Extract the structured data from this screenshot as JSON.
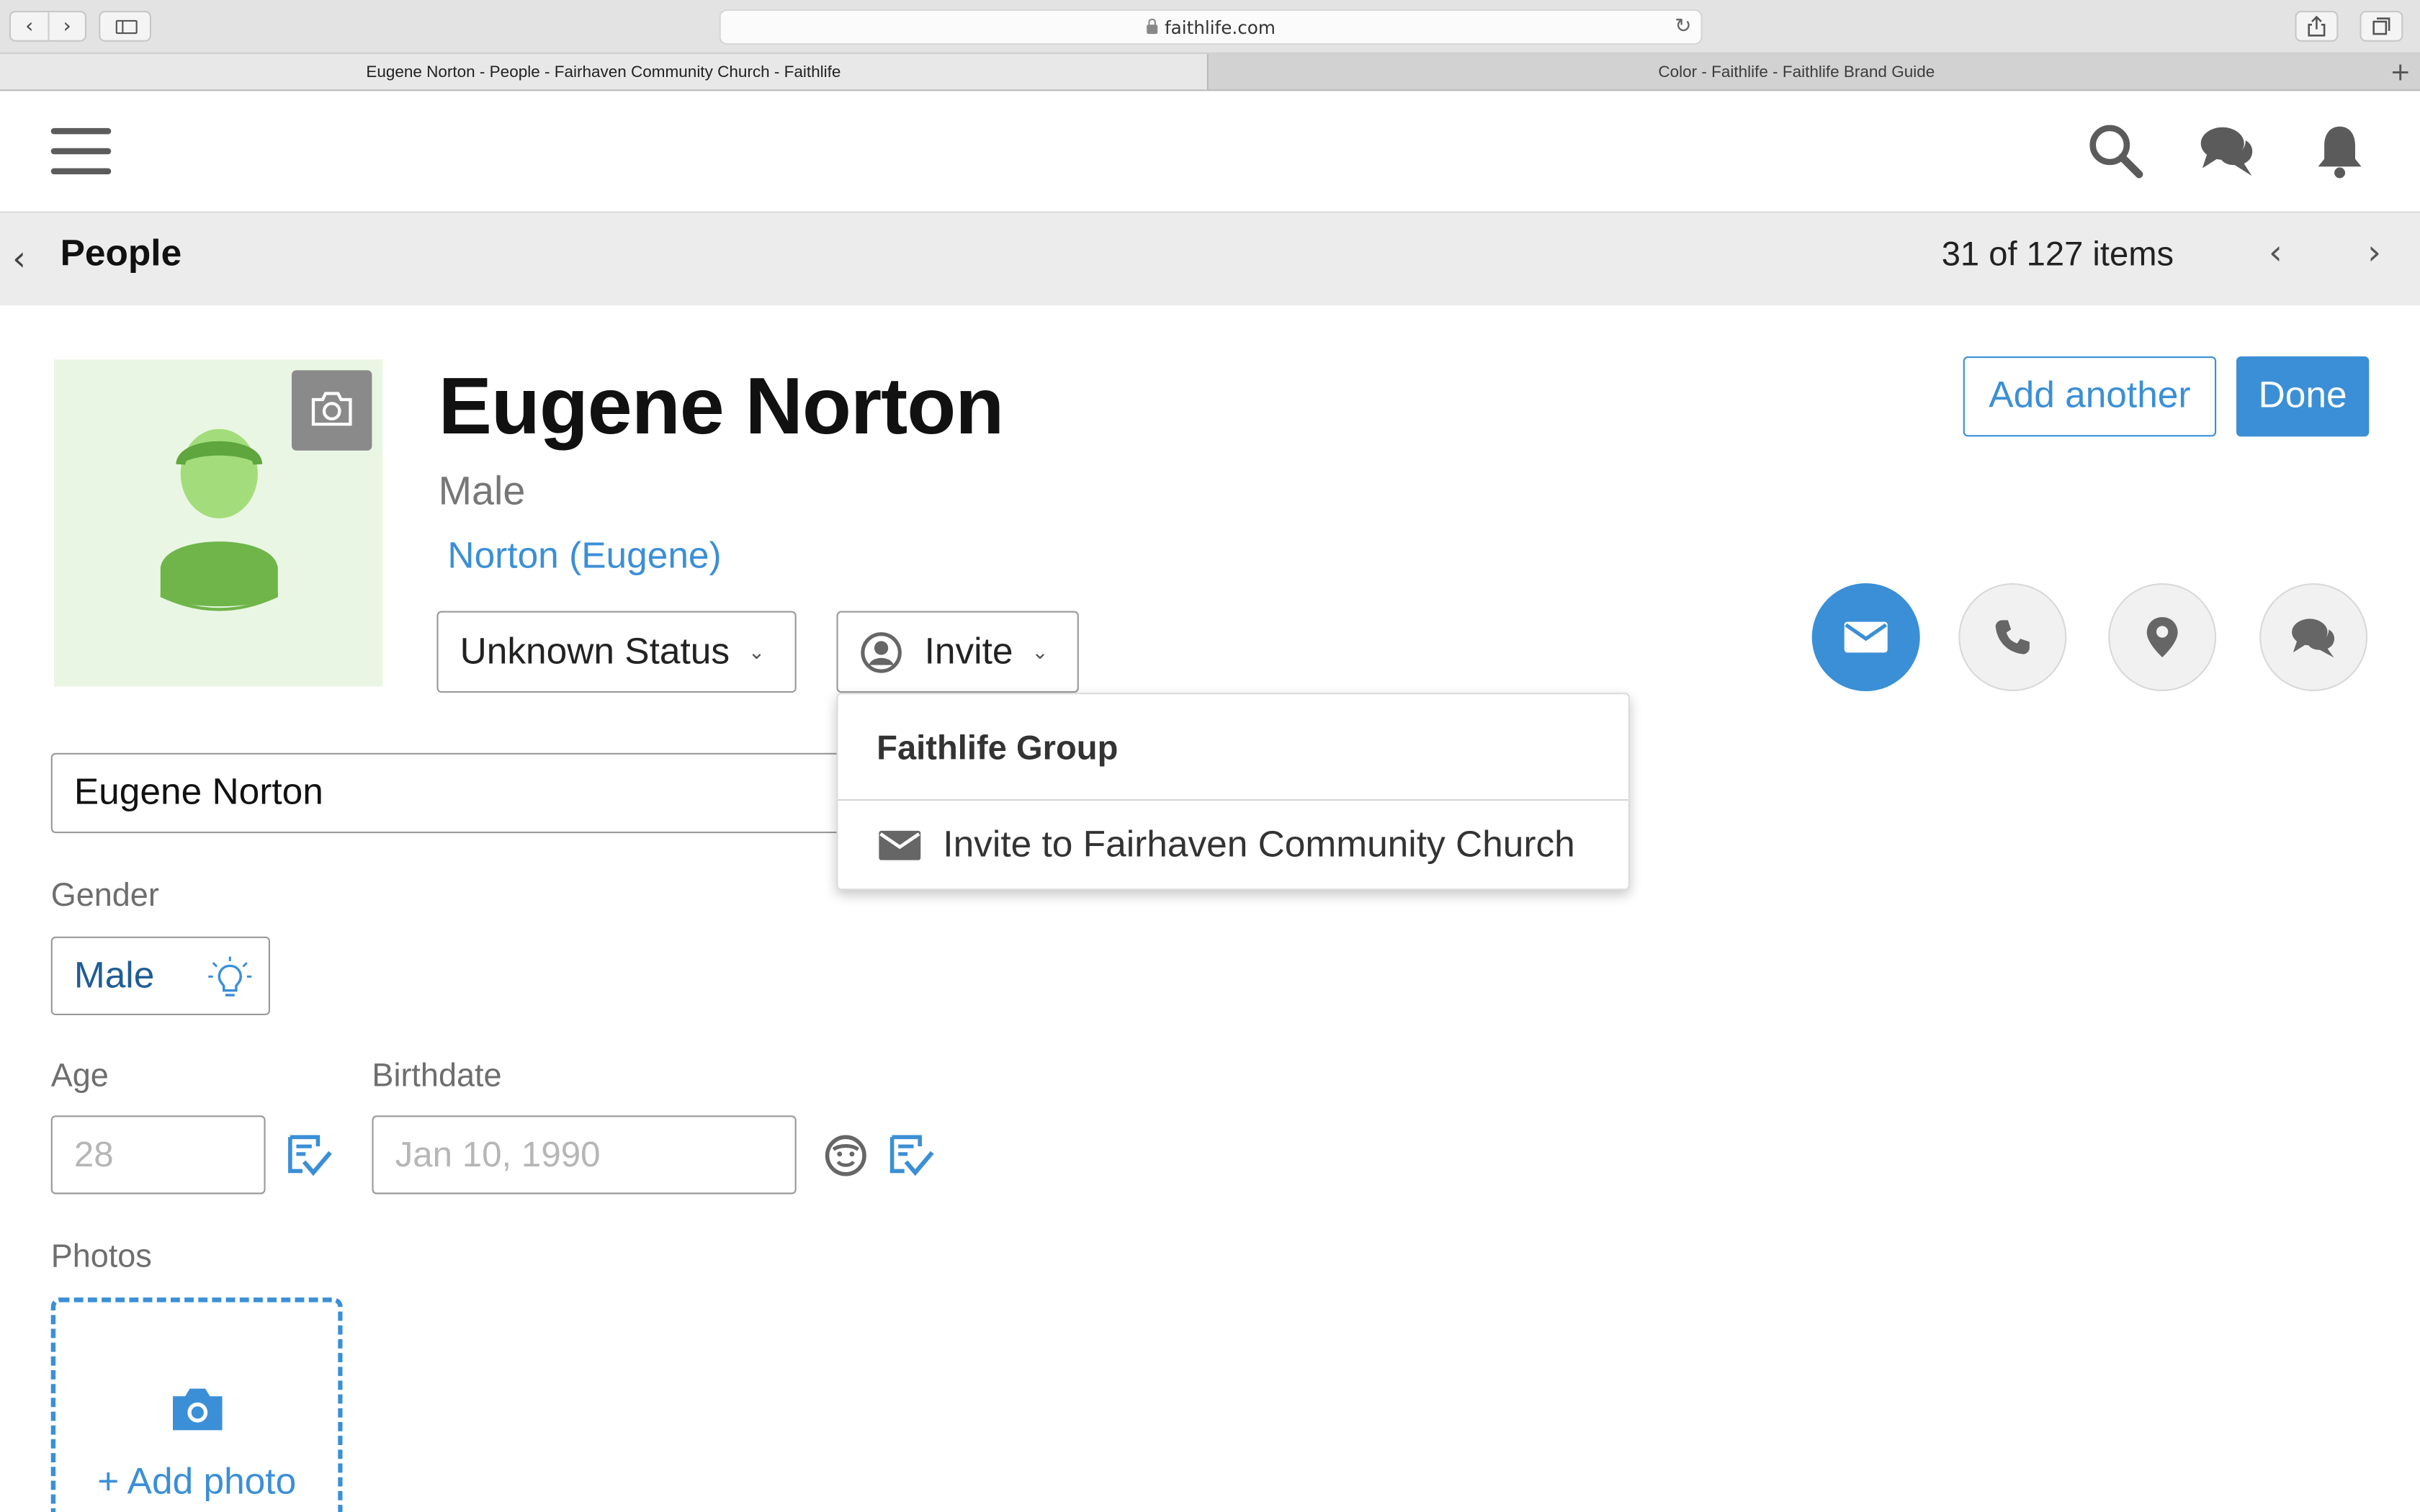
{
  "browser": {
    "url": "faithlife.com",
    "tabs": [
      {
        "label": "Eugene Norton - People - Fairhaven Community Church - Faithlife"
      },
      {
        "label": "Color - Faithlife - Faithlife Brand Guide"
      }
    ]
  },
  "subheader": {
    "title": "People",
    "count": "31 of 127 items"
  },
  "profile": {
    "name": "Eugene Norton",
    "gender": "Male",
    "alias": "Norton (Eugene)",
    "add_another_label": "Add another",
    "done_label": "Done",
    "status_label": "Unknown Status",
    "invite_label": "Invite"
  },
  "invite_menu": {
    "heading": "Faithlife Group",
    "item_label": "Invite to Fairhaven Community Church"
  },
  "form": {
    "name_value": "Eugene Norton",
    "gender_label": "Gender",
    "gender_value": "Male",
    "age_label": "Age",
    "age_placeholder": "28",
    "birthdate_label": "Birthdate",
    "birthdate_placeholder": "Jan 10, 1990",
    "photos_label": "Photos",
    "add_photo_label": "+ Add photo"
  },
  "colors": {
    "brand_blue": "#3b8fd6",
    "avatar_green": "#6fb54a"
  }
}
